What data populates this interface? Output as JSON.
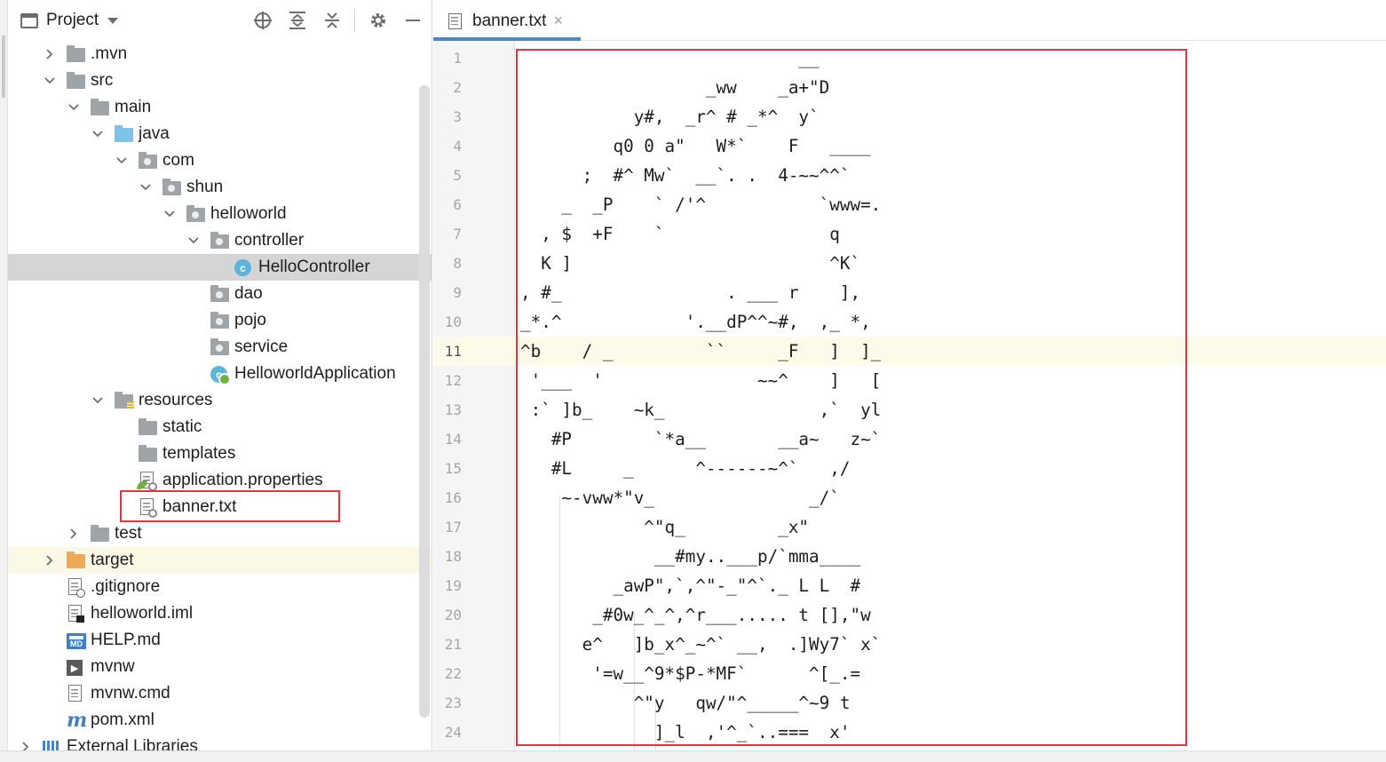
{
  "project_panel": {
    "title": "Project",
    "tree": [
      {
        "label": ".mvn",
        "depth": 1,
        "expand": "collapsed",
        "icon": "folder"
      },
      {
        "label": "src",
        "depth": 1,
        "expand": "expanded",
        "icon": "folder"
      },
      {
        "label": "main",
        "depth": 2,
        "expand": "expanded",
        "icon": "folder"
      },
      {
        "label": "java",
        "depth": 3,
        "expand": "expanded",
        "icon": "folder-source"
      },
      {
        "label": "com",
        "depth": 4,
        "expand": "expanded",
        "icon": "package"
      },
      {
        "label": "shun",
        "depth": 5,
        "expand": "expanded",
        "icon": "package"
      },
      {
        "label": "helloworld",
        "depth": 6,
        "expand": "expanded",
        "icon": "package"
      },
      {
        "label": "controller",
        "depth": 7,
        "expand": "expanded",
        "icon": "package"
      },
      {
        "label": "HelloController",
        "depth": 8,
        "expand": "none",
        "icon": "class",
        "selected": true
      },
      {
        "label": "dao",
        "depth": 7,
        "expand": "none",
        "icon": "package"
      },
      {
        "label": "pojo",
        "depth": 7,
        "expand": "none",
        "icon": "package"
      },
      {
        "label": "service",
        "depth": 7,
        "expand": "none",
        "icon": "package"
      },
      {
        "label": "HelloworldApplication",
        "depth": 7,
        "expand": "none",
        "icon": "spring-class"
      },
      {
        "label": "resources",
        "depth": 3,
        "expand": "expanded",
        "icon": "folder-resources"
      },
      {
        "label": "static",
        "depth": 4,
        "expand": "none",
        "icon": "folder"
      },
      {
        "label": "templates",
        "depth": 4,
        "expand": "none",
        "icon": "folder"
      },
      {
        "label": "application.properties",
        "depth": 4,
        "expand": "none",
        "icon": "properties-file"
      },
      {
        "label": "banner.txt",
        "depth": 4,
        "expand": "none",
        "icon": "text-file",
        "boxed": true
      },
      {
        "label": "test",
        "depth": 2,
        "expand": "collapsed",
        "icon": "folder"
      },
      {
        "label": "target",
        "depth": 1,
        "expand": "collapsed",
        "icon": "folder-excluded",
        "highlight": true
      },
      {
        "label": ".gitignore",
        "depth": 1,
        "expand": "none",
        "icon": "ignored-file"
      },
      {
        "label": "helloworld.iml",
        "depth": 1,
        "expand": "none",
        "icon": "iml-file"
      },
      {
        "label": "HELP.md",
        "depth": 1,
        "expand": "none",
        "icon": "markdown-file"
      },
      {
        "label": "mvnw",
        "depth": 1,
        "expand": "none",
        "icon": "shell-file"
      },
      {
        "label": "mvnw.cmd",
        "depth": 1,
        "expand": "none",
        "icon": "cmd-file"
      },
      {
        "label": "pom.xml",
        "depth": 1,
        "expand": "none",
        "icon": "maven-file"
      },
      {
        "label": "External Libraries",
        "depth": 0,
        "expand": "collapsed",
        "icon": "libraries"
      }
    ]
  },
  "editor": {
    "tab": {
      "label": "banner.txt",
      "close": "×"
    },
    "current_line": 11,
    "lines": [
      "                           __",
      "                  _ww    _a+\"D",
      "           y#,  _r^ # _*^  y`",
      "         q0 0 a\"   W*`    F   ____",
      "      ;  #^ Mw`  __`. .  4-~~^^`",
      "    _  _P    ` /'^           `www=.",
      "  , $  +F    `                q",
      "  K ]                         ^K`",
      ", #_                . ___ r    ],",
      "_*.^            '.__dP^^~#,  ,_ *,",
      "^b    / _         ``     _F   ]  ]_",
      " '___  '               ~~^    ]   [",
      " :` ]b_    ~k_               ,`  yl",
      "   #P        `*a__       __a~   z~`",
      "   #L     _      ^------~^`   ,/",
      "    ~-vww*\"v_               _/`",
      "            ^\"q_         _x\"",
      "             __#my..___p/`mma____",
      "         _awP\",`,^\"-_\"^`._ L L  #",
      "       _#0w_^_^,^r___..... t [],\"w",
      "      e^   ]b_x^_~^` __,  .]Wy7` x`",
      "       '=w__^9*$P-*MF`      ^[_.=",
      "           ^\"y   qw/\"^_____^~9 t",
      "             ]_l  ,'^_`..===  x'"
    ]
  },
  "colors": {
    "accent_tab": "#4a88c7",
    "selection": "#d5d5d5",
    "annotation_red": "#e5343f",
    "current_line_bg": "#fcfae8"
  }
}
